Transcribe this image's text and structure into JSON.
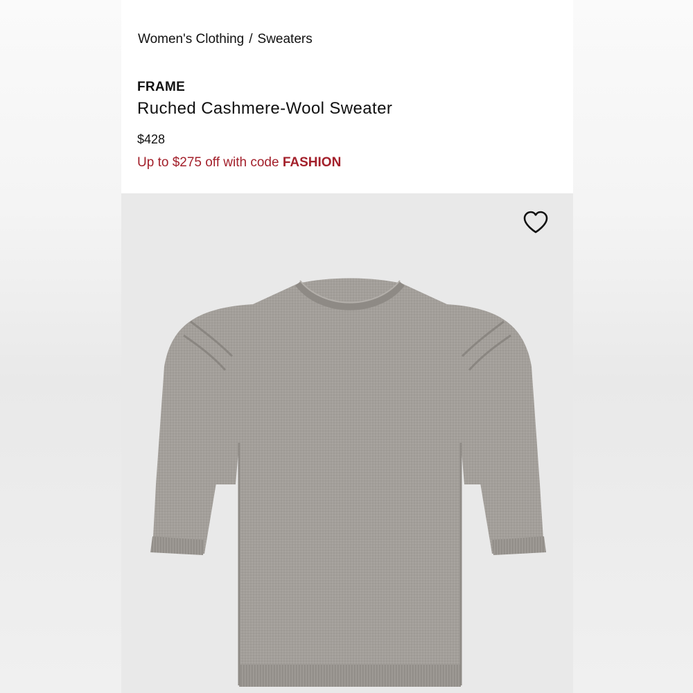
{
  "breadcrumb": {
    "category": "Women's Clothing",
    "separator": "/",
    "subcategory": "Sweaters"
  },
  "product": {
    "brand": "FRAME",
    "name": "Ruched Cashmere-Wool Sweater",
    "price": "$428",
    "promo_text": "Up to $275 off with code",
    "promo_code": "FASHION"
  },
  "colors": {
    "promo": "#a3202b",
    "sweater": "#a39f9a",
    "background": "#e9e9e9"
  },
  "icons": {
    "wishlist": "heart-outline-icon"
  }
}
